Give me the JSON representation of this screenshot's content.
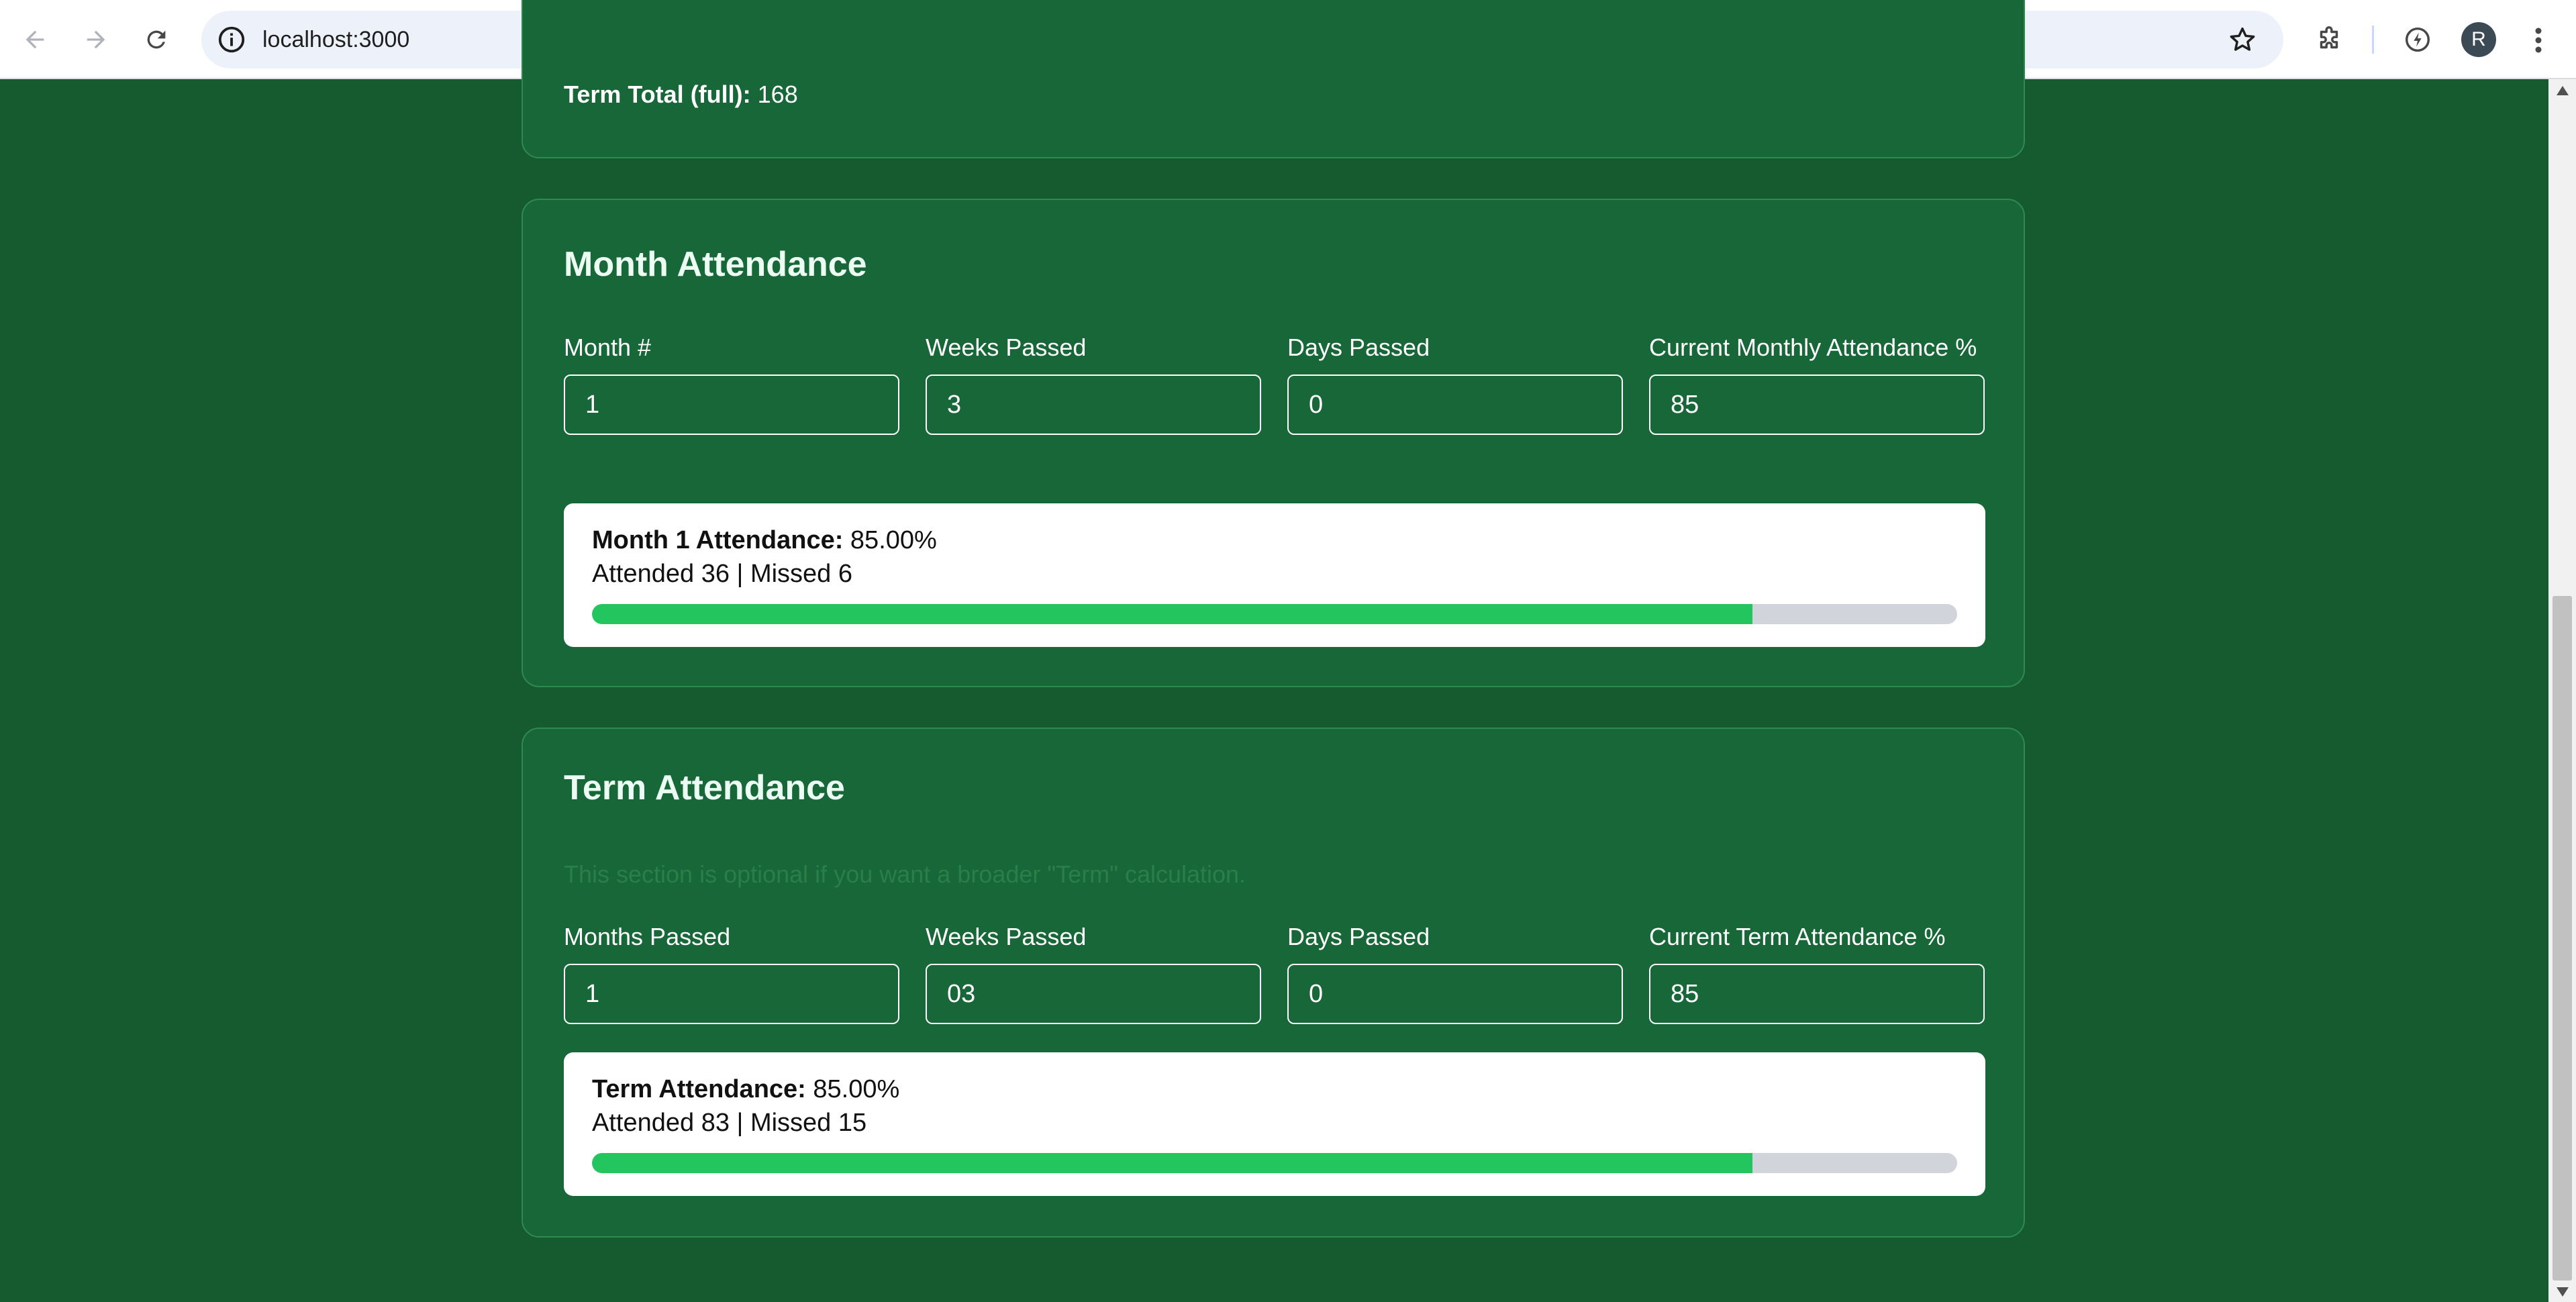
{
  "browser": {
    "url": "localhost:3000",
    "profile_initial": "R",
    "icons": [
      "back-icon",
      "forward-icon",
      "reload-icon",
      "info-icon",
      "star-icon",
      "extensions-icon",
      "performance-icon",
      "menu-icon"
    ]
  },
  "top_card": {
    "term_total_label": "Term Total (full):",
    "term_total_value": "168"
  },
  "month": {
    "title": "Month Attendance",
    "fields": [
      {
        "label": "Month #",
        "value": "1"
      },
      {
        "label": "Weeks Passed",
        "value": "3"
      },
      {
        "label": "Days Passed",
        "value": "0"
      },
      {
        "label": "Current Monthly Attendance %",
        "value": "85"
      }
    ],
    "result": {
      "heading": "Month 1 Attendance:",
      "percent_text": "85.00%",
      "summary": "Attended 36 | Missed 6",
      "progress_percent": 85
    }
  },
  "term": {
    "title": "Term Attendance",
    "note": "This section is optional if you want a broader \"Term\" calculation.",
    "fields": [
      {
        "label": "Months Passed",
        "value": "1"
      },
      {
        "label": "Weeks Passed",
        "value": "03"
      },
      {
        "label": "Days Passed",
        "value": "0"
      },
      {
        "label": "Current Term Attendance %",
        "value": "85"
      }
    ],
    "result": {
      "heading": "Term Attendance:",
      "percent_text": "85.00%",
      "summary": "Attended 83 | Missed 15",
      "progress_percent": 85
    }
  },
  "colors": {
    "page_bg": "#165a30",
    "card_bg": "#186738",
    "progress_fill": "#22c55e",
    "progress_track": "#d1d5db"
  }
}
